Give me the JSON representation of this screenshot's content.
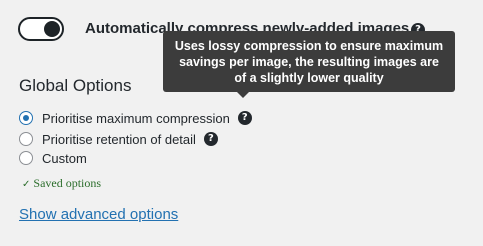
{
  "compress_toggle": {
    "label": "Automatically compress newly-added images",
    "enabled": true,
    "help_glyph": "?"
  },
  "tooltip": {
    "text": "Uses lossy compression to ensure maximum savings per image, the resulting images are of a slightly lower quality"
  },
  "global_options": {
    "title": "Global Options",
    "options": [
      {
        "label": "Prioritise maximum compression",
        "selected": true,
        "help_glyph": "?"
      },
      {
        "label": "Prioritise retention of detail",
        "selected": false,
        "help_glyph": "?"
      },
      {
        "label": "Custom",
        "selected": false
      }
    ]
  },
  "status": {
    "check_glyph": "✓",
    "saved_text": "Saved options"
  },
  "advanced_link": {
    "label": "Show advanced options"
  },
  "colors": {
    "accent": "#2271b1",
    "saved_green": "#2c6e2c",
    "tooltip_bg": "#3c3c3c",
    "background": "#f1f1f1"
  }
}
